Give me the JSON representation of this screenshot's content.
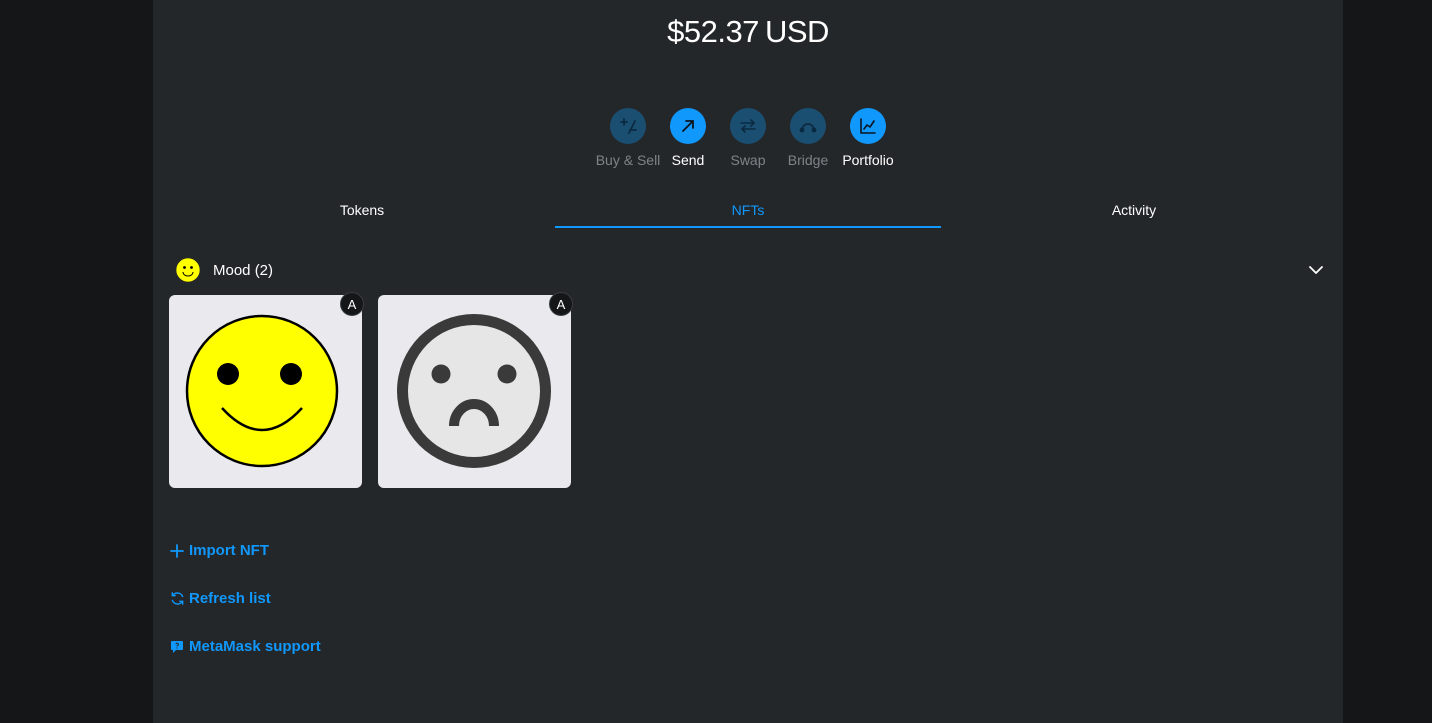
{
  "balance": {
    "amount": "$52.37",
    "currency": "USD"
  },
  "actions": [
    {
      "label": "Buy & Sell",
      "icon": "plus-minus-icon",
      "enabled": false
    },
    {
      "label": "Send",
      "icon": "arrow-up-right-icon",
      "enabled": true
    },
    {
      "label": "Swap",
      "icon": "swap-arrows-icon",
      "enabled": false
    },
    {
      "label": "Bridge",
      "icon": "bridge-icon",
      "enabled": false
    },
    {
      "label": "Portfolio",
      "icon": "chart-icon",
      "enabled": true
    }
  ],
  "tabs": [
    {
      "label": "Tokens",
      "active": false
    },
    {
      "label": "NFTs",
      "active": true
    },
    {
      "label": "Activity",
      "active": false
    }
  ],
  "collection": {
    "name": "Mood (2)",
    "icon": "smiley-icon"
  },
  "nfts": [
    {
      "badge": "A",
      "art": "smiley-face"
    },
    {
      "badge": "A",
      "art": "sad-face"
    }
  ],
  "links": {
    "import": "Import NFT",
    "refresh": "Refresh list",
    "support": "MetaMask support"
  },
  "colors": {
    "accent": "#1098fc",
    "background": "#24272a",
    "disabled_circle": "#1b4f72"
  }
}
